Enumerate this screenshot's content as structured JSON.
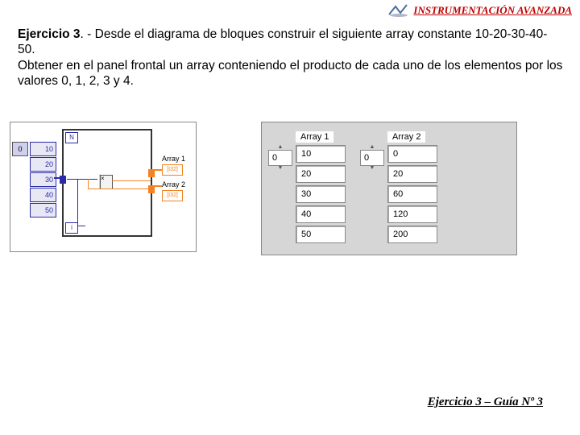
{
  "header": {
    "title": "INSTRUMENTACIÓN AVANZADA"
  },
  "exercise": {
    "label": "Ejercicio 3",
    "text1": ". - Desde el diagrama de bloques construir el siguiente array constante 10-20-30-40-50.",
    "text2": "Obtener en el panel frontal un array conteniendo el producto de cada uno de los elementos por los valores 0, 1, 2, 3 y 4."
  },
  "block_diagram": {
    "index0": "0",
    "constants": [
      "10",
      "20",
      "30",
      "40",
      "50"
    ],
    "n": "N",
    "i": "i",
    "mult": "×",
    "ind1_label": "Array 1",
    "ind2_label": "Array 2",
    "dtype": "[I32]"
  },
  "front_panel": {
    "array1": {
      "label": "Array 1",
      "index": "0",
      "values": [
        "10",
        "20",
        "30",
        "40",
        "50"
      ]
    },
    "array2": {
      "label": "Array 2",
      "index": "0",
      "values": [
        "0",
        "20",
        "60",
        "120",
        "200"
      ]
    }
  },
  "footer": {
    "text": "Ejercicio 3 – Guía Nº 3"
  }
}
